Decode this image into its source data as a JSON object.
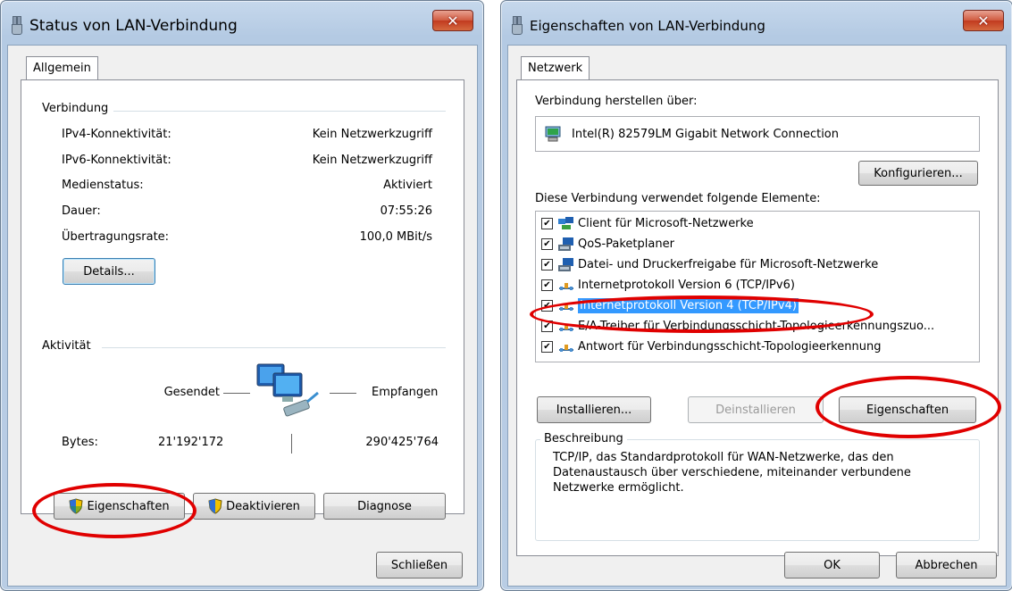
{
  "status_window": {
    "title": "Status von LAN-Verbindung",
    "close_label": "✕",
    "tab": "Allgemein",
    "connection_group": "Verbindung",
    "rows": [
      {
        "label": "IPv4-Konnektivität:",
        "value": "Kein Netzwerkzugriff"
      },
      {
        "label": "IPv6-Konnektivität:",
        "value": "Kein Netzwerkzugriff"
      },
      {
        "label": "Medienstatus:",
        "value": "Aktiviert"
      },
      {
        "label": "Dauer:",
        "value": "07:55:26"
      },
      {
        "label": "Übertragungsrate:",
        "value": "100,0 MBit/s"
      }
    ],
    "details_button": "Details...",
    "activity_group": "Aktivität",
    "sent_label": "Gesendet",
    "received_label": "Empfangen",
    "bytes_label": "Bytes:",
    "bytes_sent": "21'192'172",
    "bytes_received": "290'425'764",
    "properties_button": "Eigenschaften",
    "disable_button": "Deaktivieren",
    "diagnose_button": "Diagnose",
    "close_button": "Schließen"
  },
  "props_window": {
    "title": "Eigenschaften von LAN-Verbindung",
    "close_label": "✕",
    "tab": "Netzwerk",
    "connect_via_label": "Verbindung herstellen über:",
    "adapter_name": "Intel(R) 82579LM Gigabit Network Connection",
    "configure_button": "Konfigurieren...",
    "elements_label": "Diese Verbindung verwendet folgende Elemente:",
    "items": [
      {
        "label": "Client für Microsoft-Netzwerke",
        "checked": true,
        "icon": "network-client-icon"
      },
      {
        "label": "QoS-Paketplaner",
        "checked": true,
        "icon": "service-icon"
      },
      {
        "label": "Datei- und Druckerfreigabe für Microsoft-Netzwerke",
        "checked": true,
        "icon": "service-icon"
      },
      {
        "label": "Internetprotokoll Version 6 (TCP/IPv6)",
        "checked": true,
        "icon": "protocol-icon"
      },
      {
        "label": "Internetprotokoll Version 4 (TCP/IPv4)",
        "checked": true,
        "icon": "protocol-icon",
        "selected": true
      },
      {
        "label": "E/A-Treiber für Verbindungsschicht-Topologieerkennungszuo...",
        "checked": true,
        "icon": "protocol-icon"
      },
      {
        "label": "Antwort für Verbindungsschicht-Topologieerkennung",
        "checked": true,
        "icon": "protocol-icon"
      }
    ],
    "install_button": "Installieren...",
    "uninstall_button": "Deinstallieren",
    "properties_button": "Eigenschaften",
    "description_group": "Beschreibung",
    "description_text": "TCP/IP, das Standardprotokoll für WAN-Netzwerke, das den Datenaustausch über verschiedene, miteinander verbundene Netzwerke ermöglicht.",
    "ok_button": "OK",
    "cancel_button": "Abbrechen"
  },
  "colors": {
    "highlight": "#3399ff",
    "annotation": "#e00000"
  }
}
